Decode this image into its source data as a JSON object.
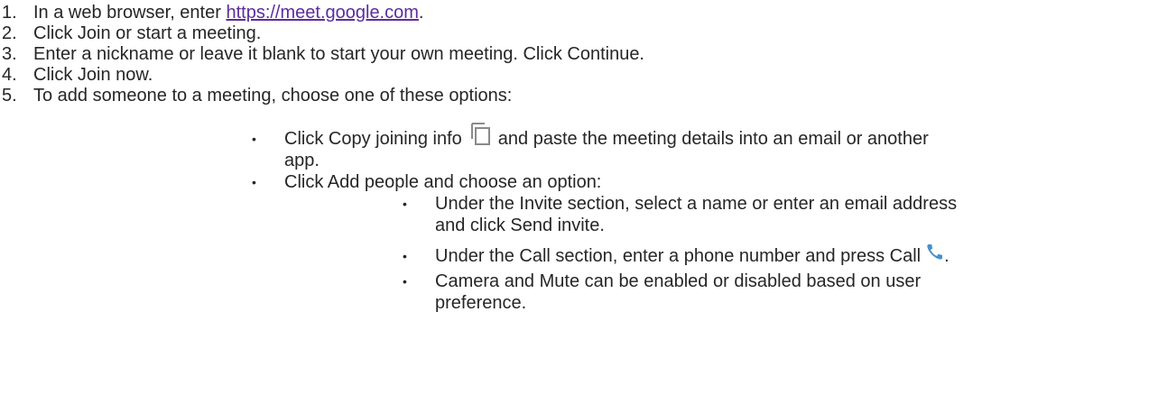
{
  "steps": [
    {
      "num": "1.",
      "before": "In a web browser, enter ",
      "link": "https://meet.google.com",
      "after": "."
    },
    {
      "num": "2.",
      "text": "Click Join or start a meeting."
    },
    {
      "num": "3.",
      "text": "Enter a nickname or leave it blank to start your own meeting. Click Continue."
    },
    {
      "num": "4.",
      "text": "Click Join now."
    },
    {
      "num": "5.",
      "text": "To add someone to a meeting, choose one of these options:"
    }
  ],
  "options": [
    {
      "before_icon": "Click Copy joining info",
      "icon": "copy-icon",
      "after_icon": "and paste the meeting details into an email or another",
      "line2": "app."
    },
    {
      "text": "Click Add people and choose an option:"
    }
  ],
  "sub_options": [
    {
      "line1": "Under the Invite section, select a name or enter an email address",
      "line2": "and click Send invite."
    },
    {
      "before_icon": "Under the Call section, enter a phone number and press Call",
      "icon": "phone-icon",
      "after_icon": "."
    },
    {
      "line1": "Camera and Mute can be enabled or disabled based on user",
      "line2": "preference."
    }
  ],
  "bullet_glyph": "•",
  "colors": {
    "text": "#262626",
    "link": "#5b2c9f",
    "icon_gray": "#8a8a8a",
    "phone_blue": "#4a8fc9"
  }
}
